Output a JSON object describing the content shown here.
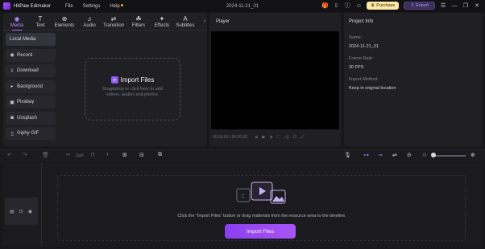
{
  "app": {
    "name": "HitPaw Edimakor",
    "document_title": "2024-11-21_01"
  },
  "menu": [
    {
      "label": "File"
    },
    {
      "label": "Settings"
    },
    {
      "label": "Help"
    }
  ],
  "titlebar_actions": {
    "purchase_label": "Purchase",
    "export_label": "Export"
  },
  "toolbar_tabs": [
    {
      "label": "Media",
      "icon": "media-icon",
      "active": true
    },
    {
      "label": "Text",
      "icon": "text-icon"
    },
    {
      "label": "Elements",
      "icon": "elements-icon"
    },
    {
      "label": "Audio",
      "icon": "audio-icon"
    },
    {
      "label": "Transition",
      "icon": "transition-icon"
    },
    {
      "label": "Filters",
      "icon": "filters-icon"
    },
    {
      "label": "Effects",
      "icon": "effects-icon"
    },
    {
      "label": "Subtitles",
      "icon": "subtitles-icon"
    }
  ],
  "sidebar": [
    {
      "label": "Local Media",
      "active": true
    },
    {
      "label": "Record"
    },
    {
      "label": "Download"
    },
    {
      "label": "Background"
    },
    {
      "label": "Pixabay"
    },
    {
      "label": "Unsplash"
    },
    {
      "label": "Giphy GIF"
    }
  ],
  "media_drop": {
    "title": "Import Files",
    "hint": "Drag&drop or click here to add videos, audios and photos."
  },
  "player": {
    "title": "Player",
    "time": "00:00:00 / 00:00:00"
  },
  "project_info": {
    "title": "Project Info",
    "fields": [
      {
        "label": "Name:",
        "value": "2024-11-21_01"
      },
      {
        "label": "Frame Rate:",
        "value": "30 FPS"
      },
      {
        "label": "Import Method:",
        "value": "Keep in original location"
      }
    ]
  },
  "timeline_toolbar": {
    "split_label": "Split"
  },
  "timeline": {
    "hint": "Click the \"Import Files\" button or drag materials from the resource area to the timeline.",
    "import_button": "Import Files"
  },
  "colors": {
    "accent": "#a855f7",
    "background": "#18181b",
    "panel": "#1f1f24",
    "purchase_bg": "#fbe7a6"
  }
}
